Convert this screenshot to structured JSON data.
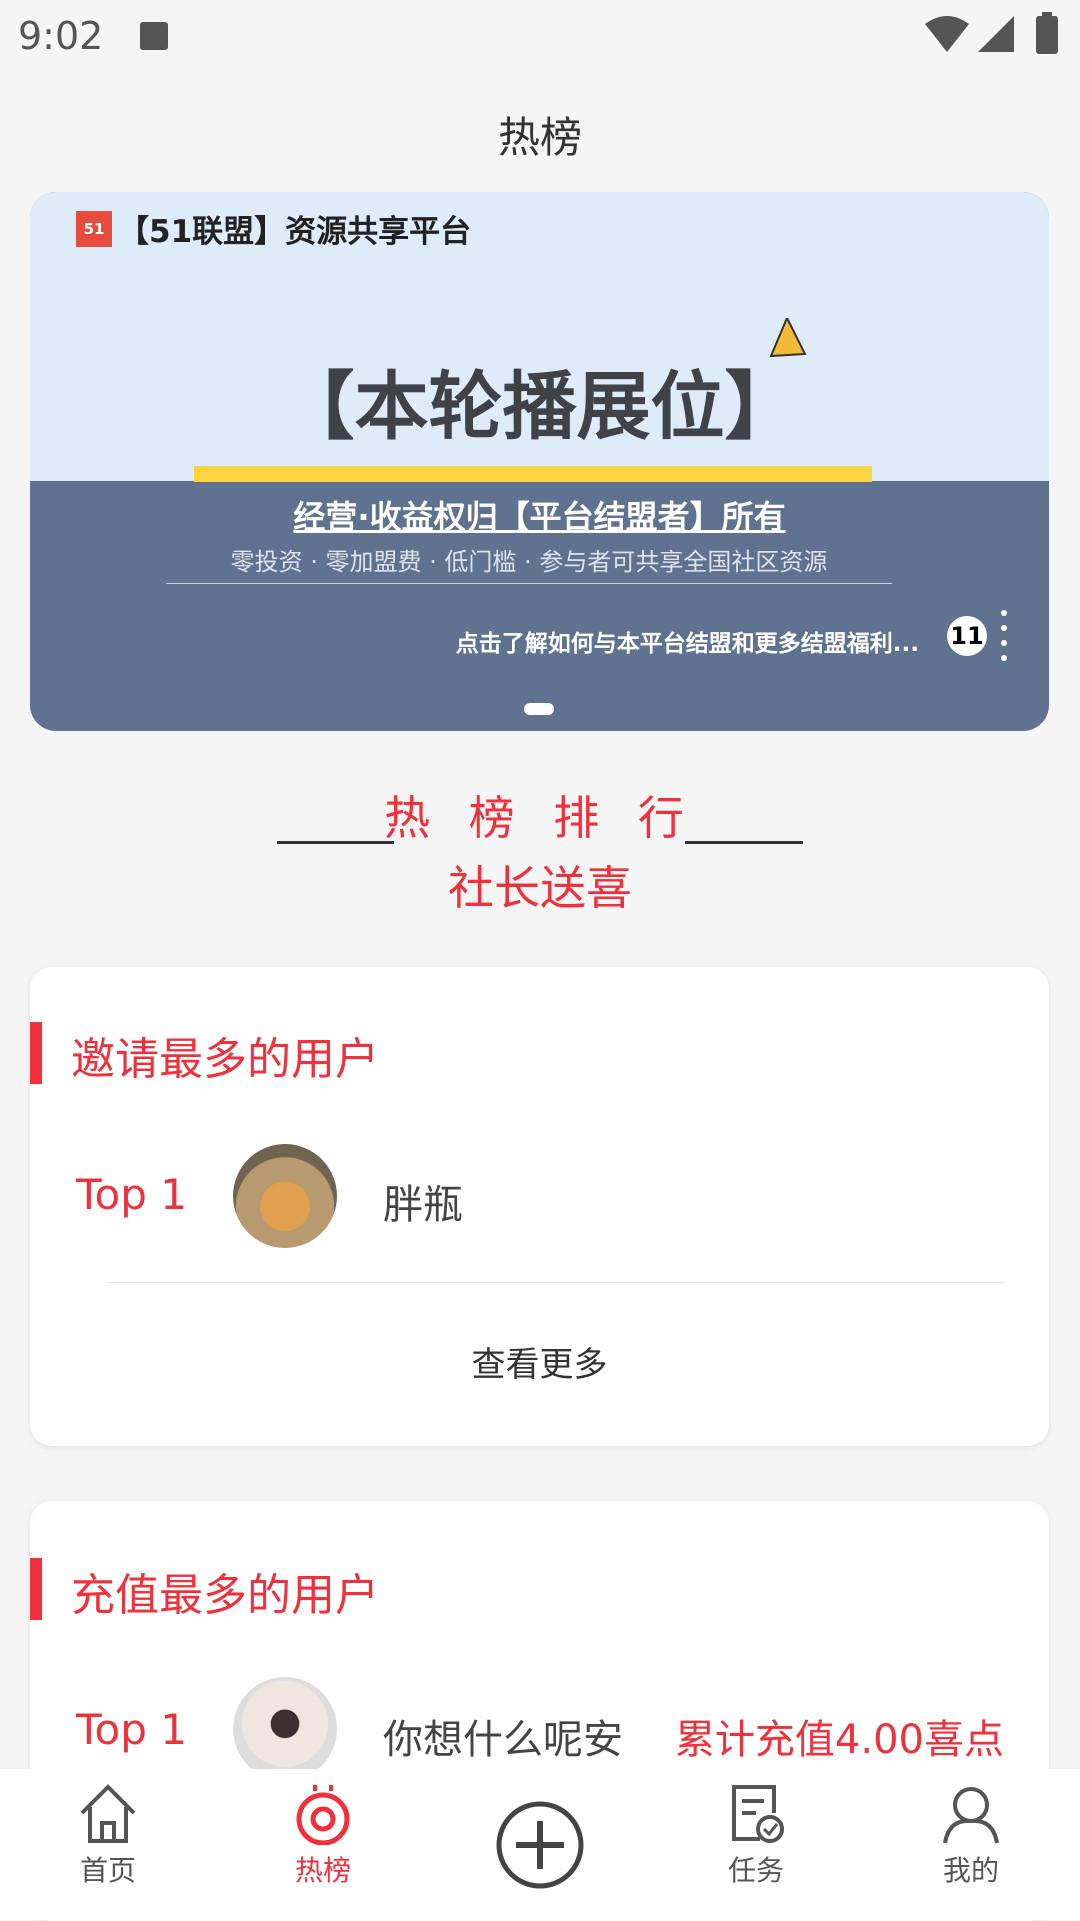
{
  "status": {
    "time": "9:02"
  },
  "header": {
    "title": "热榜"
  },
  "banner": {
    "brand": "【51联盟】资源共享平台",
    "logo_text": "51",
    "headline": "【本轮播展位】",
    "subtitle": "经营·收益权归【平台结盟者】所有",
    "features": "零投资 · 零加盟费 · 低门槛 · 参与者可共享全国社区资源",
    "cta": "点击了解如何与本平台结盟和更多结盟福利...",
    "badge": "11",
    "slide_count": 1,
    "active_slide": 1
  },
  "section": {
    "title": "热 榜 排 行",
    "subtitle": "社长送喜"
  },
  "cards": [
    {
      "title": "邀请最多的用户",
      "rows": [
        {
          "rank": "Top 1",
          "name": "胖瓶"
        }
      ],
      "more": "查看更多"
    },
    {
      "title": "充值最多的用户",
      "rows": [
        {
          "rank": "Top 1",
          "name": "你想什么呢安",
          "amount": "累计充值4.00喜点"
        }
      ]
    }
  ],
  "nav": {
    "items": [
      {
        "label": "首页",
        "icon": "home-icon"
      },
      {
        "label": "热榜",
        "icon": "hot-icon",
        "active": true
      },
      {
        "label": "",
        "icon": "plus-circle-icon"
      },
      {
        "label": "任务",
        "icon": "task-icon"
      },
      {
        "label": "我的",
        "icon": "profile-icon"
      }
    ]
  },
  "colors": {
    "accent": "#f0303a",
    "banner_dark": "#5f7391",
    "banner_light": "#deebf8",
    "highlight": "#f9d43f"
  }
}
